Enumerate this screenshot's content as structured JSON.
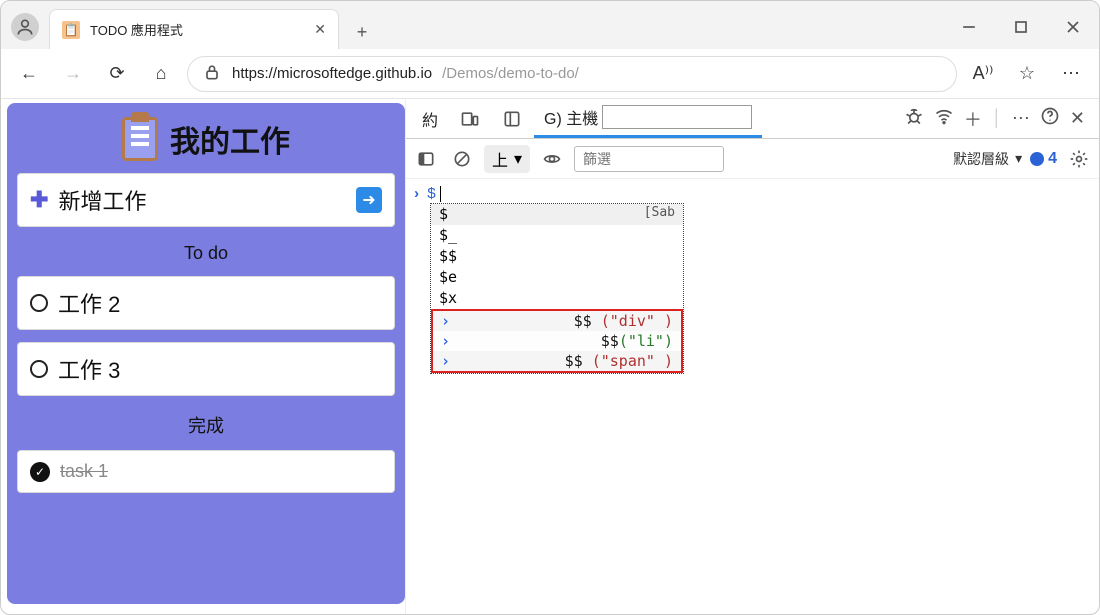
{
  "window": {
    "tab_title": "TODO 應用程式",
    "new_tab": "+"
  },
  "addr": {
    "host": "https://microsoftedge.github.io",
    "path": "/Demos/demo-to-do/"
  },
  "app": {
    "title": "我的工作",
    "add_label": "新增工作",
    "section_todo": "To do",
    "task2": "工作 2",
    "task3": "工作 3",
    "section_done": "完成",
    "task1_done": "task 1"
  },
  "devtools": {
    "tab_yue": "約",
    "tab_host_prefix": "G) 主機",
    "host_edit_value": "",
    "more": "⋯",
    "toolbar": {
      "up_label": "上",
      "filter_placeholder": "篩選",
      "level_label": "默認層級",
      "issue_count": "4"
    },
    "console": {
      "input": "$",
      "autocomplete": {
        "a0": "$",
        "a0_hint": "[Sab",
        "a1": "$_",
        "a2": "$$",
        "a3": "$e",
        "a4": "$x"
      },
      "history": {
        "h0_fn": "$$",
        "h0_arg": "(\"div\" )",
        "h1_fn": "$$",
        "h1_arg": "(\"li\")",
        "h2_fn": "$$",
        "h2_arg": "(\"span\" )"
      }
    }
  }
}
